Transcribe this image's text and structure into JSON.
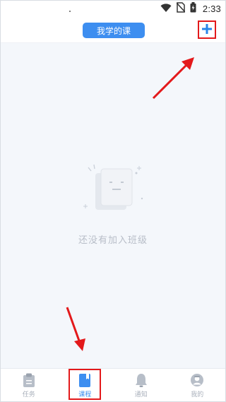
{
  "status_bar": {
    "time": "2:33",
    "icons": [
      "wifi-icon",
      "no-sim-icon",
      "battery-charging-icon"
    ]
  },
  "header": {
    "title": "我学的课",
    "add_icon": "plus-icon"
  },
  "content": {
    "empty_message": "还没有加入班级",
    "illustration": "empty-document-icon"
  },
  "tabbar": {
    "items": [
      {
        "label": "任务",
        "icon": "clipboard-icon",
        "active": false
      },
      {
        "label": "课程",
        "icon": "book-icon",
        "active": true
      },
      {
        "label": "通知",
        "icon": "bell-icon",
        "active": false
      },
      {
        "label": "我的",
        "icon": "profile-icon",
        "active": false
      }
    ]
  },
  "colors": {
    "accent": "#3d8ef0",
    "highlight": "#e3191b",
    "inactive": "#a9b0bb",
    "background": "#f4f7fb"
  }
}
